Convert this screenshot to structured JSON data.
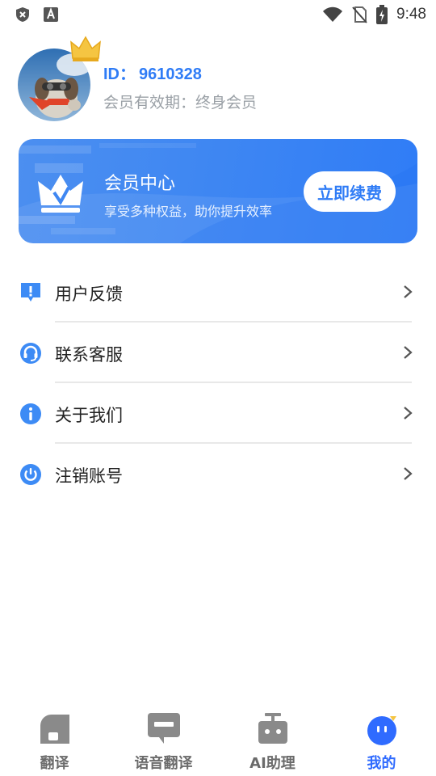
{
  "status_bar": {
    "time": "9:48",
    "left_icons": [
      "shield-x-icon",
      "font-a-icon"
    ],
    "right_icons": [
      "wifi-icon",
      "no-sim-icon",
      "battery-charging-icon"
    ]
  },
  "profile": {
    "id_label": "ID：",
    "id_value": "9610328",
    "membership_status": "会员有效期：终身会员",
    "avatar_icon": "dog-avatar",
    "badge_icon": "crown-icon"
  },
  "member_card": {
    "title": "会员中心",
    "subtitle": "享受多种权益，助你提升效率",
    "button_label": "立即续费",
    "icon": "vip-crown-icon"
  },
  "menu": {
    "items": [
      {
        "label": "用户反馈",
        "icon": "feedback-icon"
      },
      {
        "label": "联系客服",
        "icon": "headset-icon"
      },
      {
        "label": "关于我们",
        "icon": "info-icon"
      },
      {
        "label": "注销账号",
        "icon": "power-icon"
      }
    ]
  },
  "bottom_nav": {
    "items": [
      {
        "label": "翻译",
        "icon": "home-icon",
        "active": false
      },
      {
        "label": "语音翻译",
        "icon": "chat-icon",
        "active": false
      },
      {
        "label": "AI助理",
        "icon": "robot-icon",
        "active": false
      },
      {
        "label": "我的",
        "icon": "profile-face-icon",
        "active": true
      }
    ]
  },
  "colors": {
    "accent": "#2f7cf6",
    "nav_active": "#2f6bff",
    "nav_inactive": "#6b6b6b",
    "divider": "#e8e8e8"
  }
}
